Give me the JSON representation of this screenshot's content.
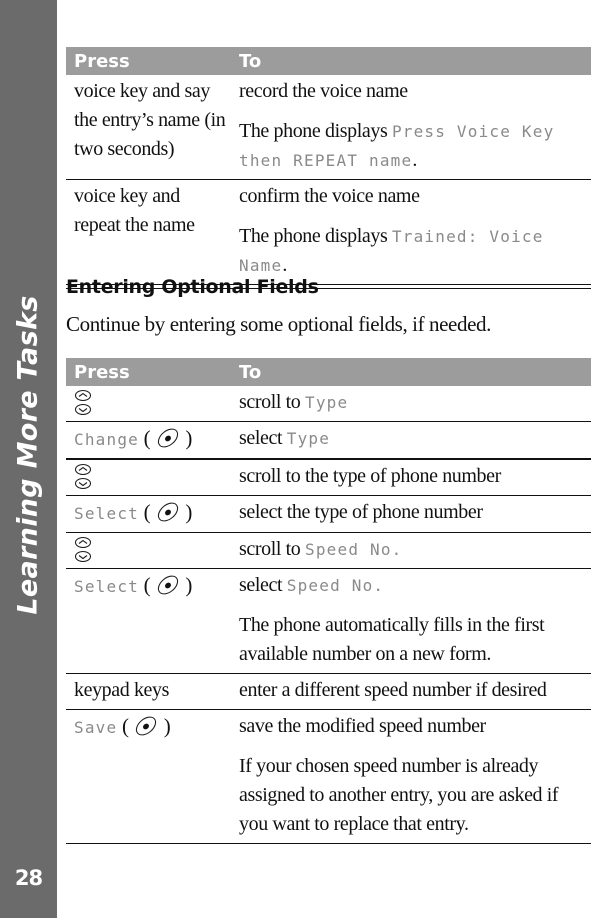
{
  "sidebar": {
    "title": "Learning More Tasks",
    "page_number": "28"
  },
  "table1": {
    "header": {
      "press": "Press",
      "to": "To"
    },
    "rows": [
      {
        "press": "voice key and say the entry’s name (in two seconds)",
        "to": [
          {
            "text": "record the voice name"
          },
          {
            "text": "The phone displays ",
            "lcd": "Press Voice Key then REPEAT name",
            "suffix": "."
          }
        ]
      },
      {
        "press": "voice key and repeat the name",
        "to": [
          {
            "text": "confirm the voice name"
          },
          {
            "text": "The phone displays ",
            "lcd": "Trained: Voice Name",
            "suffix": "."
          }
        ]
      }
    ]
  },
  "section": {
    "heading": "Entering Optional Fields",
    "body": "Continue by entering some optional fields, if needed."
  },
  "table2": {
    "header": {
      "press": "Press",
      "to": "To"
    },
    "rows": [
      {
        "press_icon": "scroll-key-icon",
        "to_text": "scroll to ",
        "to_lcd": "Type"
      },
      {
        "press_lcd": "Change",
        "press_icon": "select-key-icon",
        "to_text": "select ",
        "to_lcd": "Type"
      },
      {
        "press_icon": "scroll-key-icon",
        "to_text": "scroll to the type of phone number"
      },
      {
        "press_lcd": "Select",
        "press_icon": "select-key-icon",
        "to_text": "select the type of phone number"
      },
      {
        "press_icon": "scroll-key-icon",
        "to_text": "scroll to ",
        "to_lcd": "Speed No."
      },
      {
        "press_lcd": "Select",
        "press_icon": "select-key-icon",
        "to_text": "select ",
        "to_lcd": "Speed No.",
        "note": "The phone automatically fills in the first available number on a new form."
      },
      {
        "press": "keypad keys",
        "to_text": "enter a different speed number if desired"
      },
      {
        "press_lcd": "Save",
        "press_icon": "select-key-icon",
        "to_text": "save the modified speed number",
        "note": "If your chosen speed number is already assigned to another entry, you are asked if you want to replace that entry."
      }
    ]
  }
}
